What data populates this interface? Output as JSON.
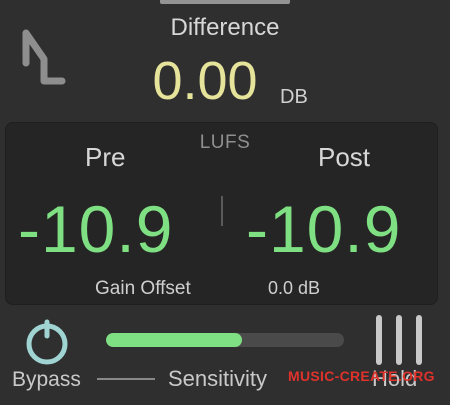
{
  "header": {
    "difference_label": "Difference",
    "difference_value": "0.00",
    "difference_unit": "DB"
  },
  "meter": {
    "unit_label": "LUFS",
    "pre_label": "Pre",
    "pre_value": "-10.9",
    "post_label": "Post",
    "post_value": "-10.9",
    "gain_offset_label": "Gain Offset",
    "gain_offset_value": "0.0 dB"
  },
  "controls": {
    "bypass_label": "Bypass",
    "sensitivity_label": "Sensitivity",
    "sensitivity_level": 0.57,
    "hold_label": "Hold"
  },
  "watermark": {
    "text": "MUSIC-CREATE.ORG"
  },
  "colors": {
    "background": "#2f2f30",
    "panel": "#252525",
    "accent_green": "#7ee082",
    "accent_yellow": "#e6e49b",
    "bypass_teal": "#9fd4d2",
    "watermark_red": "#e0312b"
  },
  "icons": {
    "logo": "nl-logo-icon",
    "bypass": "power-knob-icon",
    "hold": "hold-bars-icon"
  }
}
